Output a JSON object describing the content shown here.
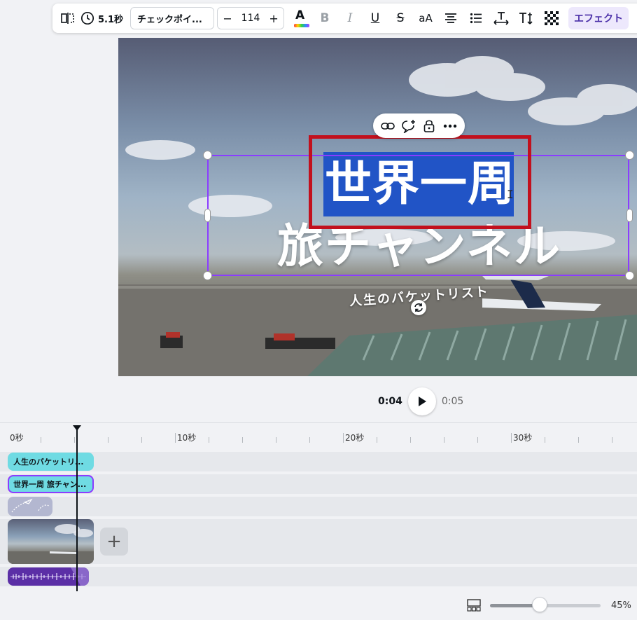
{
  "toolbar": {
    "duration": "5.1秒",
    "font_name": "チェックポイ...",
    "font_size": "114",
    "size_minus": "−",
    "size_plus": "+",
    "color_glyph": "A",
    "bold_glyph": "B",
    "italic_glyph": "I",
    "underline_glyph": "U",
    "strike_glyph": "S",
    "case_glyph": "aA",
    "effect_label": "エフェクト"
  },
  "canvas": {
    "title_line1": "世界一周",
    "title_line2": "旅チャンネル",
    "subtitle": "人生のバケットリスト"
  },
  "playback": {
    "current_time": "0:04",
    "end_time": "0:05"
  },
  "timeline": {
    "ruler_labels": [
      "0秒",
      "10秒",
      "20秒",
      "30秒"
    ],
    "tracks": {
      "subtitle_clip": "人生のバケットリ...",
      "title_clip": "世界一周 旅チャン..."
    },
    "add_label": "+"
  },
  "zoom": {
    "value_label": "45%",
    "level": 0.45
  },
  "colors": {
    "accent": "#8b3dff",
    "highlight": "#c2101d",
    "text_selection": "#2154c6",
    "text_clip": "#6fdbe3",
    "audio_clip": "#5b2fa6"
  }
}
